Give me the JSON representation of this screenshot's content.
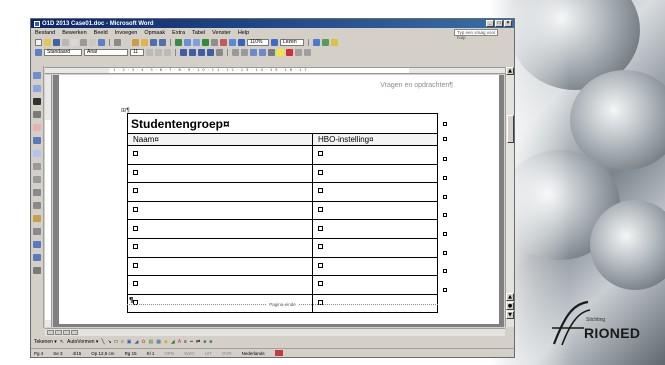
{
  "window": {
    "title": "O1D 2013 Case01.doc - Microsoft Word",
    "controls": [
      "_",
      "□",
      "×"
    ]
  },
  "menu": {
    "items": [
      "Bestand",
      "Bewerken",
      "Beeld",
      "Invoegen",
      "Opmaak",
      "Extra",
      "Tabel",
      "Venster",
      "Help"
    ],
    "help_box": "Typ een vraag voor hulp"
  },
  "format_toolbar": {
    "style": "Standaard",
    "font": "Arial",
    "size": "11",
    "zoom": "110%",
    "layout": "Lezen"
  },
  "document": {
    "header_text": "Vragen en opdrachten¶",
    "anchor_mark": "⊞¶",
    "table": {
      "title": "Studentengroep¤",
      "headers": [
        "Naam¤",
        "HBO-instelling¤"
      ],
      "row_count": 9
    },
    "page_end_label": "Pagina-einde"
  },
  "draw_toolbar": {
    "draw_label": "Tekenen ▾",
    "autoshapes_label": "AutoVormen ▾"
  },
  "status": {
    "page": "Pg 4",
    "section": "Se 3",
    "pages": "4/15",
    "position": "Op 12,5 cm",
    "line": "Rg 15",
    "column": "Kl 1",
    "modes": [
      "OPN",
      "WZG",
      "UIT",
      "OVR"
    ],
    "language": "Nederlands"
  },
  "logo": {
    "brand": "RIONED",
    "small": "Stichting"
  },
  "colors": {
    "titlebar": "#0a246a",
    "chrome": "#d4d0c8",
    "doc_bg": "#808080"
  }
}
